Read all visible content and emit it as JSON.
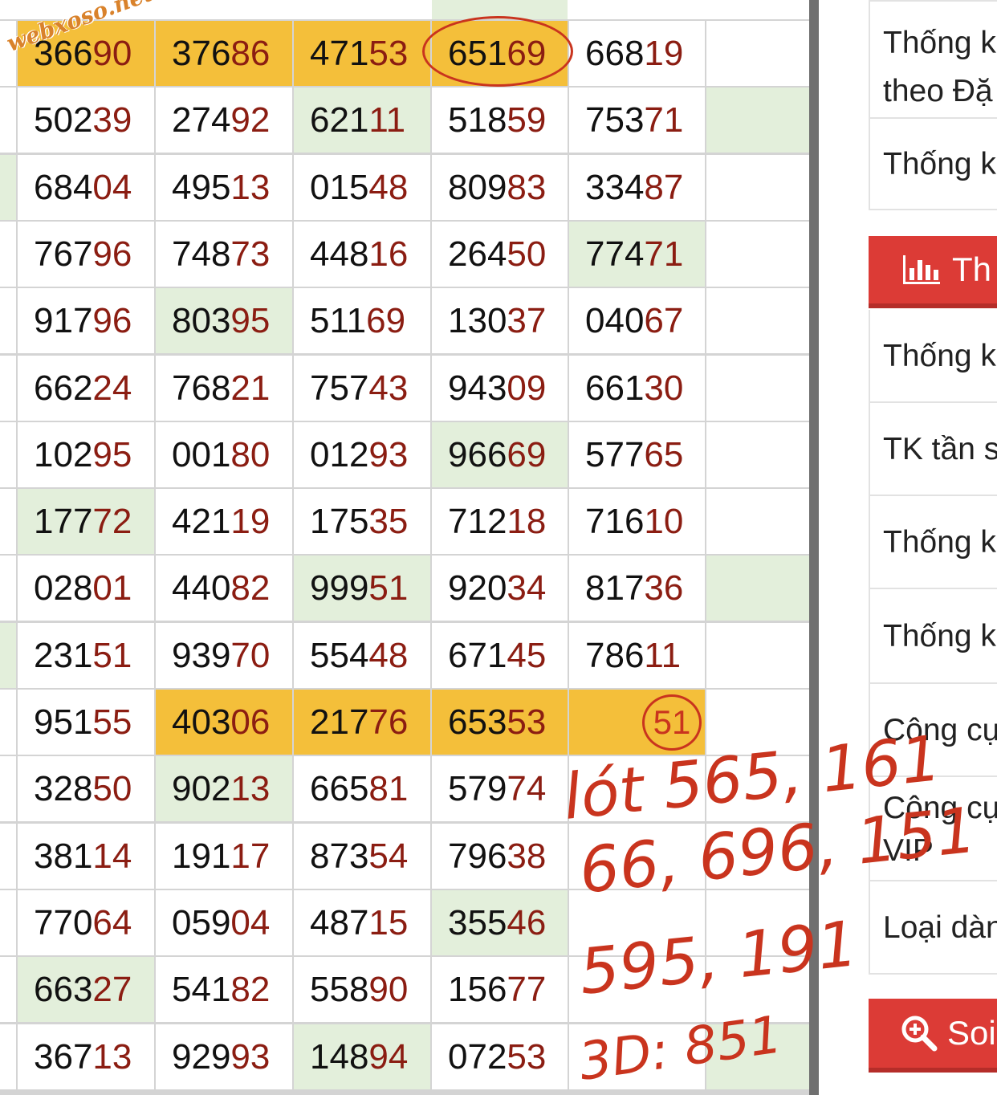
{
  "watermark": "webxoso.net",
  "table": {
    "rows": [
      [
        "36690",
        "37686",
        "47153",
        "65169",
        "66819",
        ""
      ],
      [
        "50239",
        "27492",
        "62111",
        "51859",
        "75371",
        ""
      ],
      [
        "68404",
        "49513",
        "01548",
        "80983",
        "33487",
        ""
      ],
      [
        "76796",
        "74873",
        "44816",
        "26450",
        "77471",
        ""
      ],
      [
        "91796",
        "80395",
        "51169",
        "13037",
        "04067",
        ""
      ],
      [
        "66224",
        "76821",
        "75743",
        "94309",
        "66130",
        ""
      ],
      [
        "10295",
        "00180",
        "01293",
        "96669",
        "57765",
        ""
      ],
      [
        "17772",
        "42119",
        "17535",
        "71218",
        "71610",
        ""
      ],
      [
        "02801",
        "44082",
        "99951",
        "92034",
        "81736",
        ""
      ],
      [
        "23151",
        "93970",
        "55448",
        "67145",
        "78611",
        ""
      ],
      [
        "95155",
        "40306",
        "21776",
        "65353",
        "",
        ""
      ],
      [
        "32850",
        "90213",
        "66581",
        "57974",
        "",
        ""
      ],
      [
        "38114",
        "19117",
        "87354",
        "79638",
        "",
        ""
      ],
      [
        "77064",
        "05904",
        "48715",
        "35546",
        "",
        ""
      ],
      [
        "66327",
        "54182",
        "55890",
        "15677",
        "",
        ""
      ],
      [
        "36713",
        "92993",
        "14894",
        "07253",
        "",
        ""
      ]
    ],
    "circled_number": "51"
  },
  "handwritten": {
    "line1": "lót 565, 161",
    "line2": "66, 696, 151",
    "line3": "595, 191",
    "line4": "3D: 851"
  },
  "sidebar": {
    "items": [
      {
        "line1": "Thống k",
        "line2": "theo Đặ"
      },
      {
        "line1": "Thống k"
      }
    ],
    "red_header": "Th",
    "items2": [
      "Thống k",
      "TK tần s",
      "Thống k",
      "Thống k",
      "Công cụ"
    ],
    "vip_item": {
      "line1": "Công cụ",
      "line2": "VIP"
    },
    "items3": [
      "Loại dàn"
    ],
    "red_button": "Soi"
  },
  "colors": {
    "highlight_orange": "#f4bf3a",
    "highlight_green": "#e3efdb",
    "tail_digits": "#8b1d12",
    "sidebar_red": "#dc3b36",
    "ink_red": "#c9341e"
  }
}
